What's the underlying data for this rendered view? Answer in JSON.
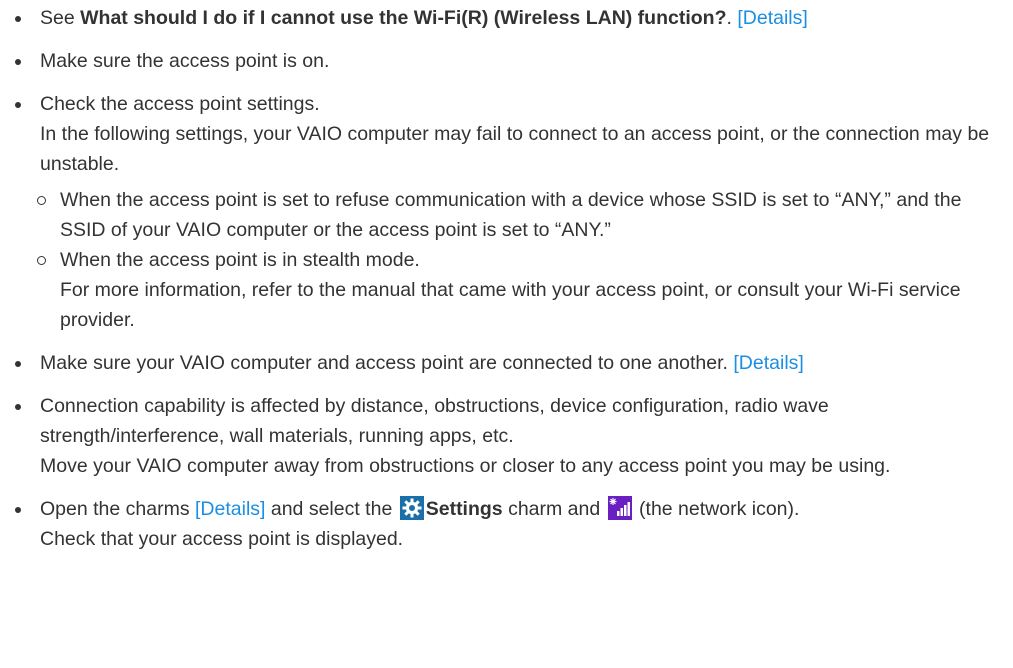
{
  "items": [
    {
      "prefix": "See ",
      "bold": "What should I do if I cannot use the Wi-Fi(R) (Wireless LAN) function?",
      "suffix": ". ",
      "link": "[Details]"
    },
    {
      "text": "Make sure the access point is on."
    },
    {
      "line1": "Check the access point settings.",
      "line2": "In the following settings, your VAIO computer may fail to connect to an access point, or the connection may be unstable.",
      "sub": [
        {
          "text": "When the access point is set to refuse communication with a device whose SSID is set to “ANY,” and the SSID of your VAIO computer or the access point is set to “ANY.”"
        },
        {
          "line1": "When the access point is in stealth mode.",
          "line2": "For more information, refer to the manual that came with your access point, or consult your Wi-Fi service provider."
        }
      ]
    },
    {
      "text": "Make sure your VAIO computer and access point are connected to one another. ",
      "link": "[Details]"
    },
    {
      "line1": "Connection capability is affected by distance, obstructions, device configuration, radio wave strength/interference, wall materials, running apps, etc.",
      "line2": "Move your VAIO computer away from obstructions or closer to any access point you may be using."
    },
    {
      "part1": "Open the charms ",
      "link": "[Details]",
      "part2": " and select the ",
      "settings_icon": "settings-gear-icon",
      "settings_bold": "Settings",
      "part3": " charm and ",
      "network_icon": "network-signal-icon",
      "part4": " (the network icon).",
      "line2": "Check that your access point is displayed."
    }
  ],
  "colors": {
    "link": "#1a8fe3",
    "text": "#333333",
    "icon_bg": "#1b6fa8",
    "network_bg": "#6a1fc2"
  }
}
